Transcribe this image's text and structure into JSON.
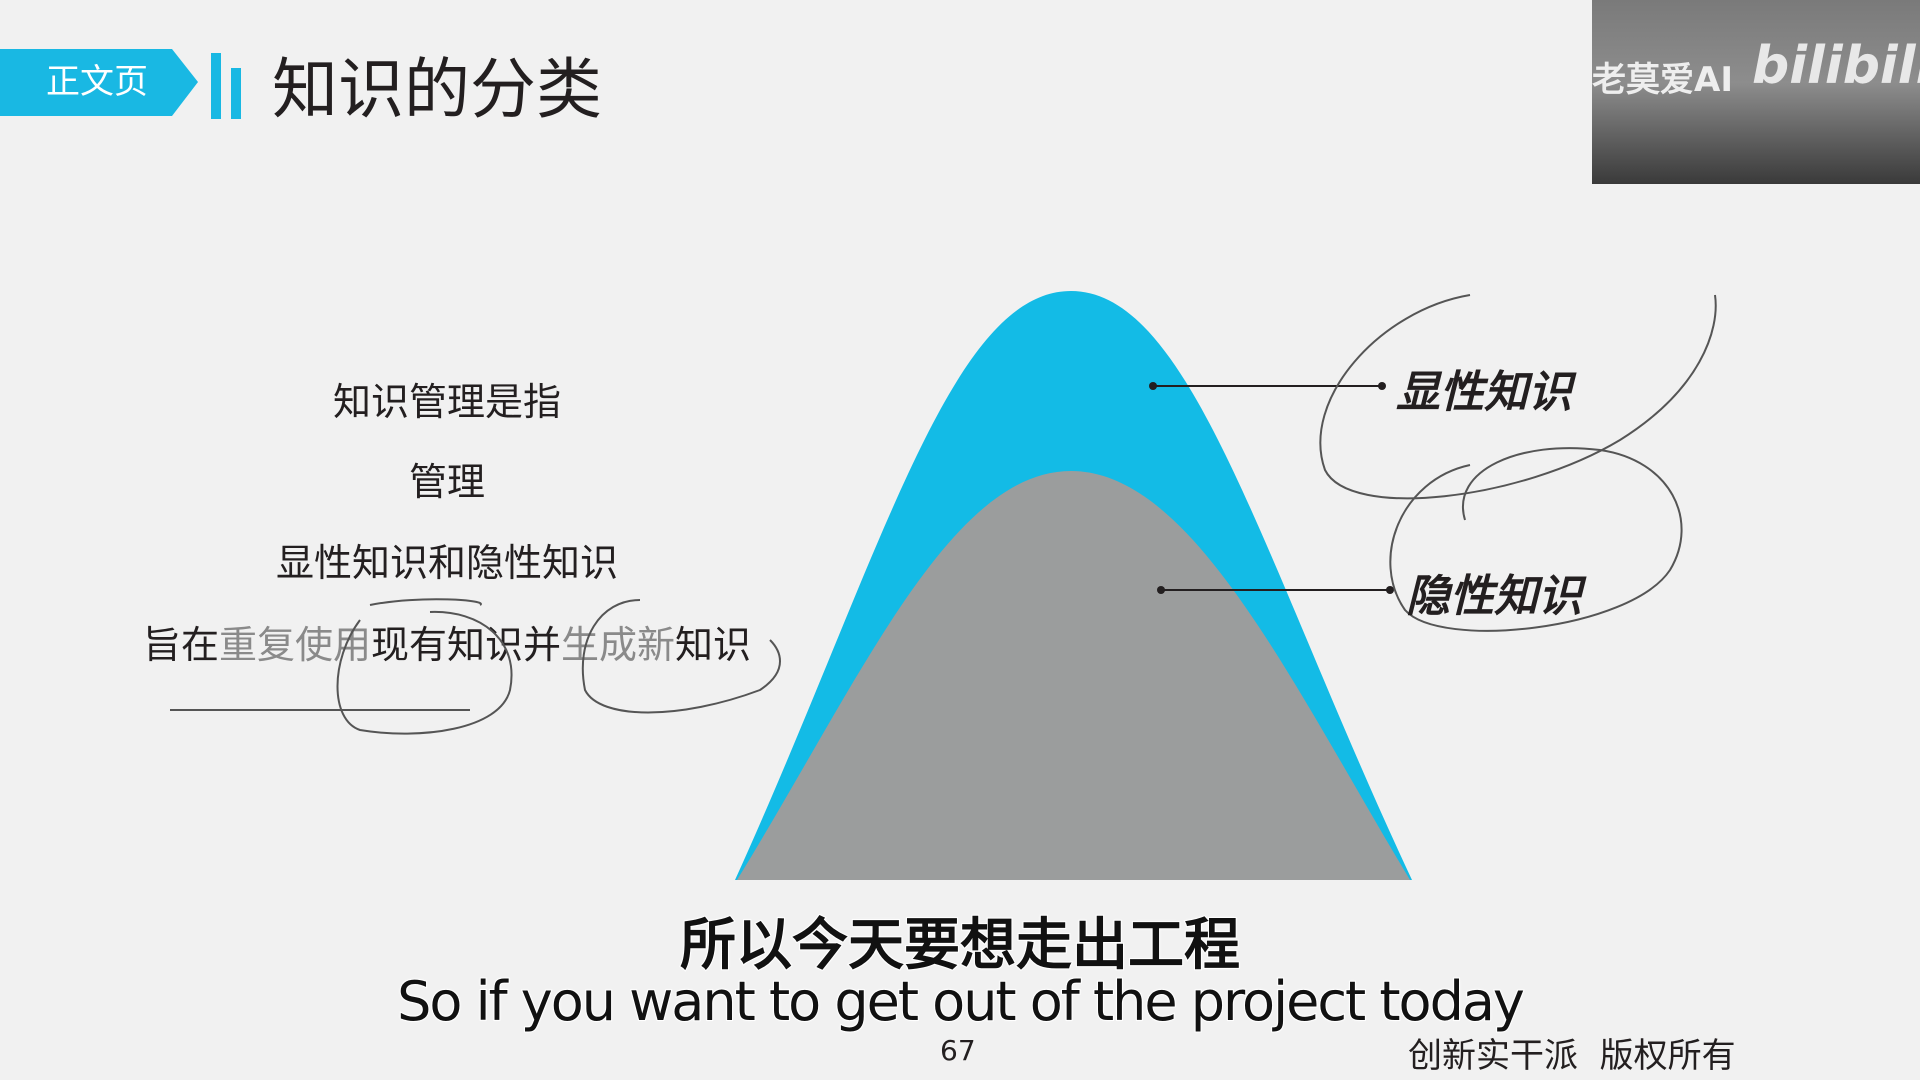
{
  "header": {
    "tag": "正文页",
    "title": "知识的分类"
  },
  "webcam": {
    "channel": "老莫爱AI",
    "watermark": "bilibili"
  },
  "body_text": {
    "line1": "知识管理是指",
    "line2": "管理",
    "line3": "显性知识和隐性知识",
    "line4_parts": [
      "旨在",
      "重复使用",
      "现有知识并",
      "生成新",
      "知识"
    ]
  },
  "diagram": {
    "explicit_label": "显性知识",
    "tacit_label": "隐性知识",
    "colors": {
      "explicit": "#13bbe6",
      "tacit": "#9b9d9d"
    }
  },
  "subtitles": {
    "zh": "所以今天要想走出工程",
    "en": "So if you want to get out of the project today"
  },
  "footer": {
    "page_number": "67",
    "copyright": "创新实干派  版权所有"
  }
}
